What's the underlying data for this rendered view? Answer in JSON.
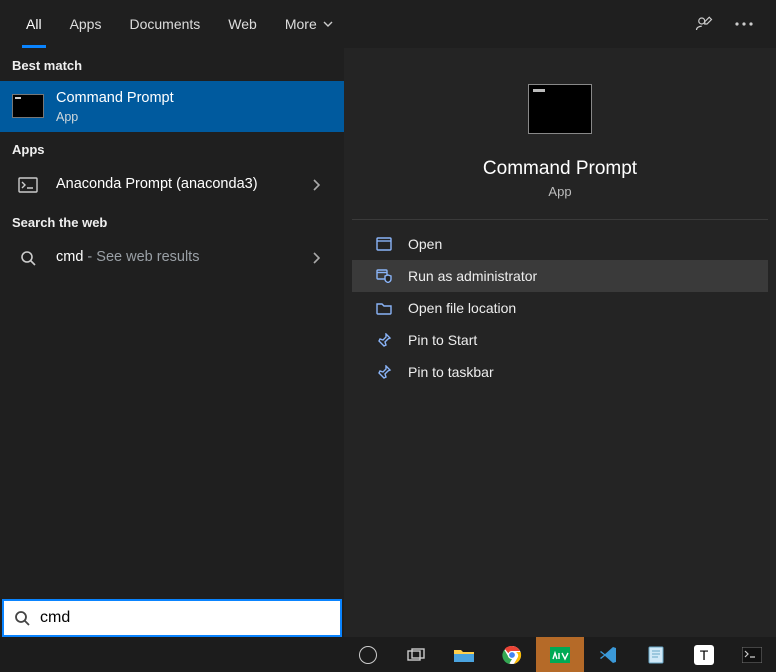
{
  "tabs": {
    "all": "All",
    "apps": "Apps",
    "documents": "Documents",
    "web": "Web",
    "more": "More"
  },
  "left": {
    "bestmatch_header": "Best match",
    "bestmatch_title": "Command Prompt",
    "bestmatch_sub": "App",
    "apps_header": "Apps",
    "anaconda_title": "Anaconda Prompt (anaconda3)",
    "web_header": "Search the web",
    "web_query": "cmd",
    "web_suffix": " - See web results"
  },
  "preview": {
    "title": "Command Prompt",
    "sub": "App",
    "actions": {
      "open": "Open",
      "admin": "Run as administrator",
      "location": "Open file location",
      "pinstart": "Pin to Start",
      "pintaskbar": "Pin to taskbar"
    }
  },
  "search": {
    "value": "cmd"
  }
}
